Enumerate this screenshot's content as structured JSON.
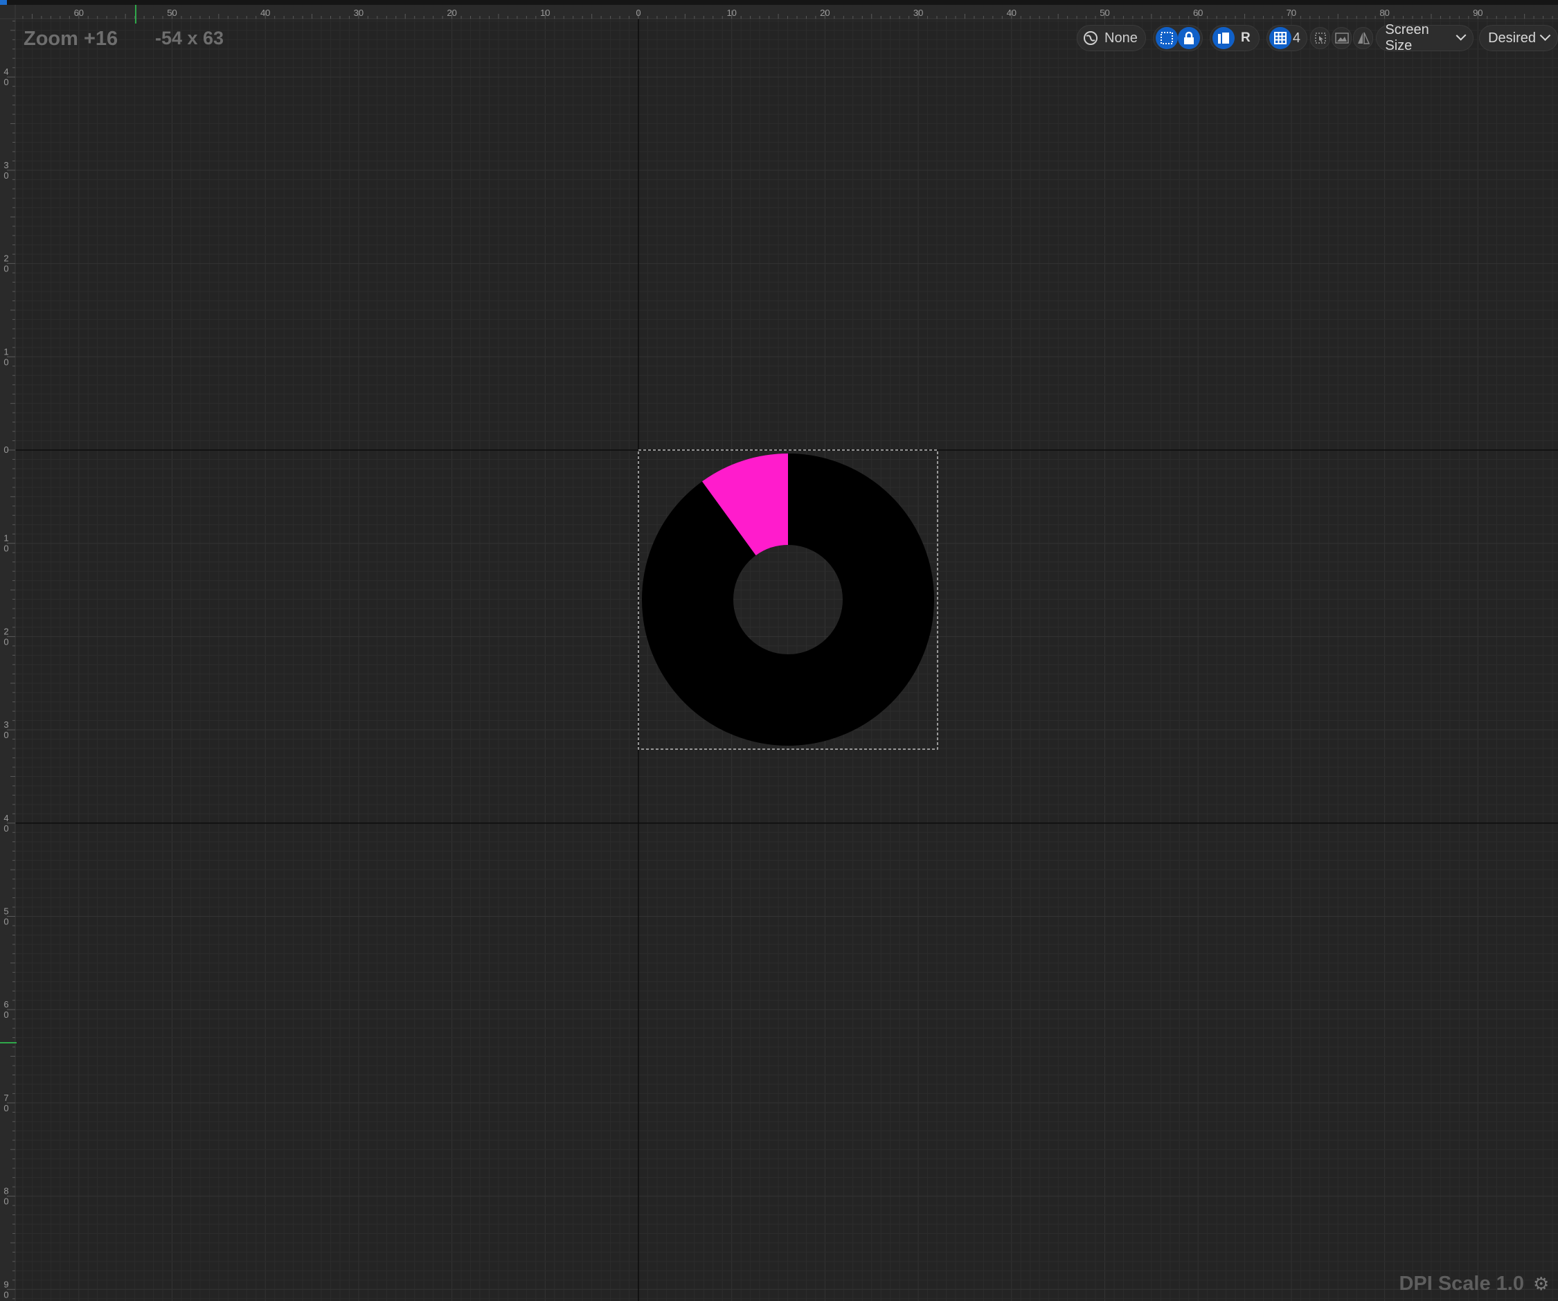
{
  "viewport": {
    "zoom_label": "Zoom +16",
    "cursor_readout": "-54 x 63",
    "dpi_label": "DPI Scale 1.0"
  },
  "ruler": {
    "top_labels": [
      "60",
      "50",
      "40",
      "30",
      "20",
      "10",
      "0",
      "10",
      "20",
      "30",
      "40",
      "50",
      "60",
      "70",
      "80",
      "90"
    ],
    "left_labels": [
      "4 0",
      "3 0",
      "2 0",
      "1 0",
      "0",
      "1 0",
      "2 0",
      "3 0",
      "4 0",
      "5 0",
      "6 0",
      "7 0",
      "8 0",
      "9 0"
    ]
  },
  "toolbar": {
    "background_mode_label": "None",
    "grid_snap_value": "4",
    "respect_locks_label": "R",
    "screen_size_label": "Screen Size",
    "fill_mode_label": "Desired"
  },
  "widget": {
    "progress_fraction": 0.1,
    "fill_color": "#ff1ccc",
    "track_color": "#000000"
  },
  "colors": {
    "canvas_bg": "#242424",
    "grid_minor": "#2c2c2c",
    "grid_major": "#333333",
    "origin_axis": "#0c0c0c",
    "accent": "#1060c8"
  },
  "icons": {
    "background_mode": "globe-icon",
    "show_bounds": "dotted-square-icon",
    "lock": "lock-icon",
    "localize": "map-icon",
    "grid": "grid-icon",
    "select": "cursor-icon",
    "image": "image-icon",
    "flip": "flip-icon",
    "settings": "gear-icon"
  }
}
